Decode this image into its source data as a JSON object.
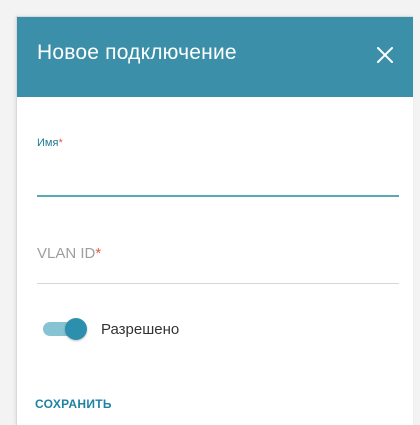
{
  "dialog": {
    "title": "Новое подключение",
    "close_icon": "close-icon"
  },
  "form": {
    "name": {
      "label": "Имя",
      "required_mark": "*",
      "value": ""
    },
    "vlan_id": {
      "placeholder": "VLAN ID",
      "required_mark": "*",
      "value": ""
    },
    "enable_toggle": {
      "label": "Разрешено",
      "checked": true
    },
    "save_label": "СОХРАНИТЬ"
  },
  "colors": {
    "header": "#3b8fa8",
    "accent": "#2c8fae",
    "required": "#e05a47"
  }
}
